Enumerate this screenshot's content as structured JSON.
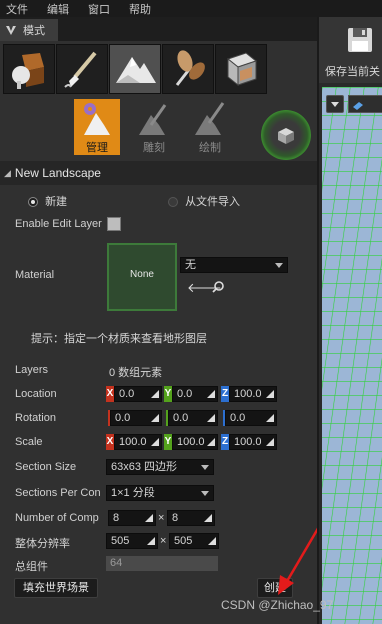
{
  "menubar": {
    "items": [
      "文件",
      "编辑",
      "窗口",
      "帮助"
    ]
  },
  "tab": {
    "label": "模式"
  },
  "subtools": [
    {
      "label": "管理",
      "active": true
    },
    {
      "label": "雕刻",
      "active": false
    },
    {
      "label": "绘制",
      "active": false
    }
  ],
  "section": {
    "title": "New Landscape"
  },
  "source": {
    "option_new": "新建",
    "option_import": "从文件导入",
    "selected": "新建"
  },
  "enable_edit_layer": {
    "label": "Enable Edit Layer",
    "checked": false
  },
  "material": {
    "label": "Material",
    "thumb_text": "None",
    "value": "无"
  },
  "hint": "提示：指定一个材质来查看地形图层",
  "layers": {
    "label": "Layers",
    "value": "0 数组元素"
  },
  "location": {
    "label": "Location",
    "x": "0.0",
    "y": "0.0",
    "z": "100.0"
  },
  "rotation": {
    "label": "Rotation",
    "x": "0.0",
    "y": "0.0",
    "z": "0.0"
  },
  "scale": {
    "label": "Scale",
    "x": "100.0",
    "y": "100.0",
    "z": "100.0"
  },
  "section_size": {
    "label": "Section Size",
    "value": "63x63 四边形"
  },
  "sections_per_comp": {
    "label": "Sections Per Con",
    "value": "1×1 分段"
  },
  "number_of_comp": {
    "label": "Number of Comp",
    "x": "8",
    "y": "8",
    "sep": "×"
  },
  "overall_res": {
    "label": "整体分辨率",
    "x": "505",
    "y": "505",
    "sep": "×"
  },
  "total_components": {
    "label": "总组件",
    "value": "64"
  },
  "buttons": {
    "fill_world": "填充世界场景",
    "create": "创建"
  },
  "toolbar_right": {
    "save_label": "保存当前关"
  },
  "watermark": "CSDN @Zhichao_97",
  "colors": {
    "accent": "#e08a16",
    "axis_x": "#c4321e",
    "axis_y": "#54a21c",
    "axis_z": "#2c6fd0",
    "grid": "#2fd13a"
  }
}
